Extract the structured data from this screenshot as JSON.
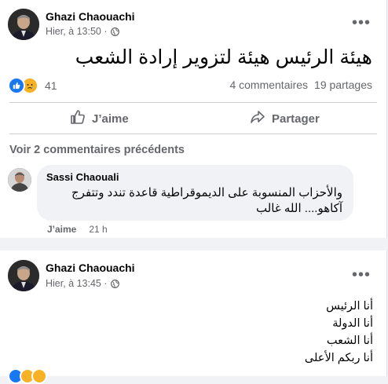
{
  "post1": {
    "author": "Ghazi Chaouachi",
    "timestamp": "Hier, à 13:50 ·",
    "text": "هيئة الرئيس هيئة لتزوير إرادة الشعب",
    "reaction_count": "41",
    "comments_count": "4 commentaires",
    "shares_count": "19 partages",
    "like_label": "J’aime",
    "share_label": "Partager",
    "prev_comments_label": "Voir 2 commentaires précédents",
    "comment": {
      "author": "Sassi Chaouali",
      "line1": "والأحزاب المنسوبة على الديموقراطية قاعدة تندد وتتفرج",
      "line2": "آكاهو.... الله غالب",
      "like_label": "J’aime",
      "time": "21 h"
    }
  },
  "post2": {
    "author": "Ghazi Chaouachi",
    "timestamp": "Hier, à 13:45 ·",
    "lines": [
      "أنا الرئيس",
      "أنا الدولة",
      "أنا الشعب",
      "أنا ربكم الأعلى"
    ]
  },
  "icons": {
    "privacy": "globe-icon",
    "more": "more-horizontal-icon",
    "like": "thumbs-up-icon",
    "share": "share-arrow-icon"
  },
  "colors": {
    "like_blue": "#1877f2",
    "sad_yellow": "#f7b125",
    "secondary_text": "#65676b"
  }
}
